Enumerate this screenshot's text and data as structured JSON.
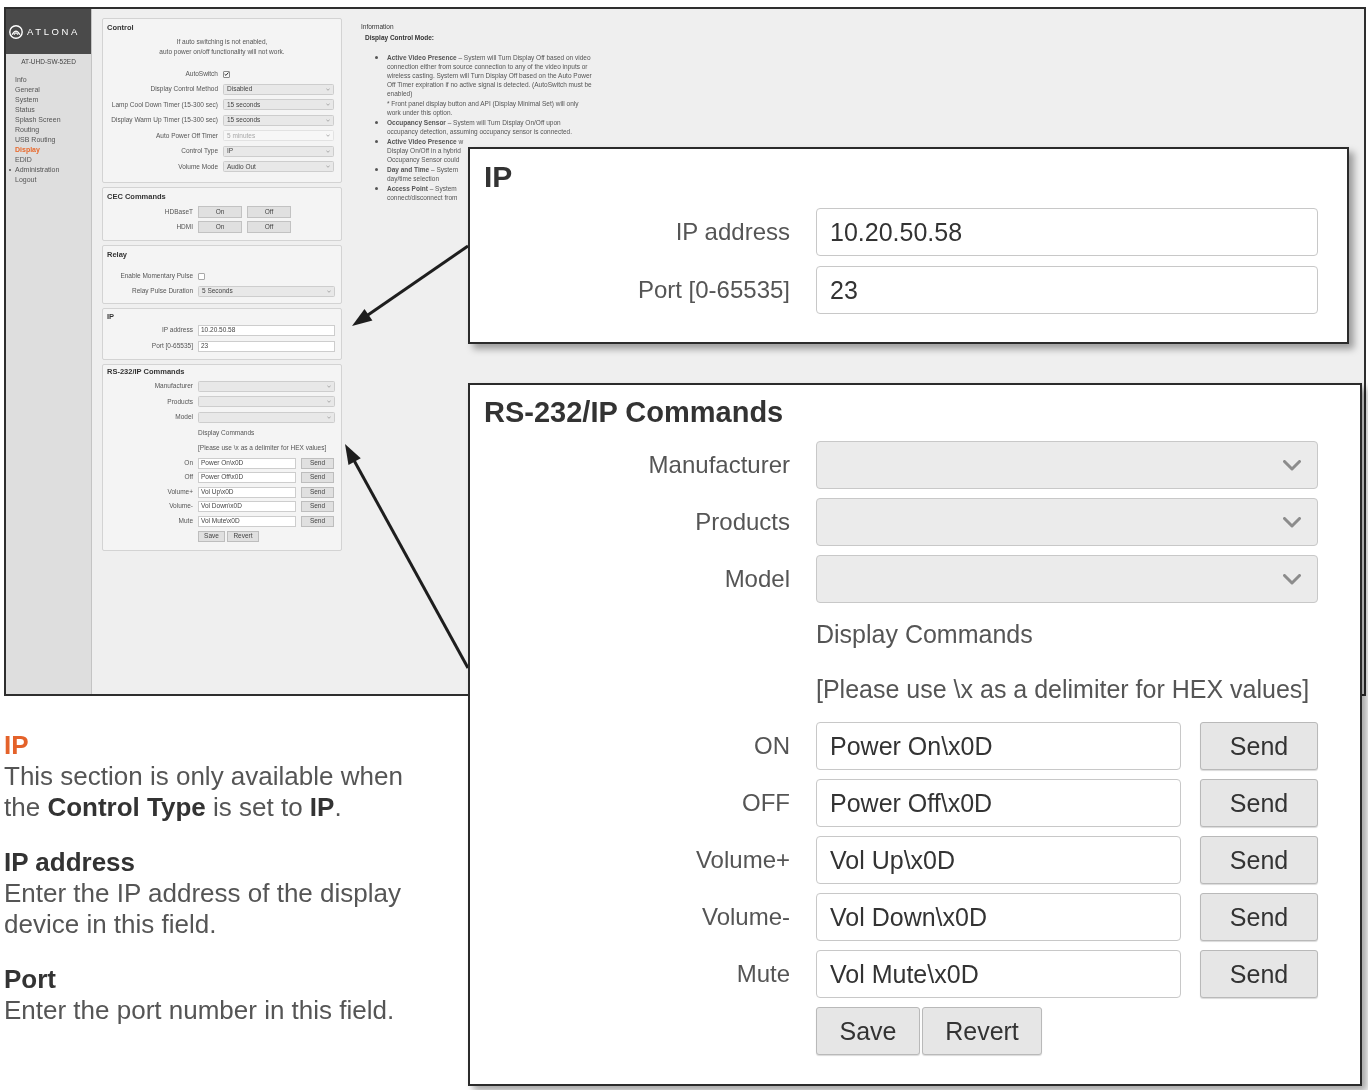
{
  "screenshot": {
    "sidebar": {
      "logo": "ATLONA",
      "device": "AT-UHD-SW-52ED",
      "items": [
        {
          "label": "Info",
          "selected": false,
          "expandable": false
        },
        {
          "label": "General",
          "selected": false,
          "expandable": false
        },
        {
          "label": "System",
          "selected": false,
          "expandable": false
        },
        {
          "label": "Status",
          "selected": false,
          "expandable": false
        },
        {
          "label": "Splash Screen",
          "selected": false,
          "expandable": false
        },
        {
          "label": "Routing",
          "selected": false,
          "expandable": false
        },
        {
          "label": "USB Routing",
          "selected": false,
          "expandable": false
        },
        {
          "label": "Display",
          "selected": true,
          "expandable": false
        },
        {
          "label": "EDID",
          "selected": false,
          "expandable": false
        },
        {
          "label": "Administration",
          "selected": false,
          "expandable": true
        },
        {
          "label": "Logout",
          "selected": false,
          "expandable": false
        }
      ]
    },
    "control": {
      "title": "Control",
      "notice": [
        "If auto switching is not enabled,",
        "auto power on/off functionality will not work."
      ],
      "fields": [
        {
          "kind": "checkbox",
          "label": "AutoSwitch",
          "checked": true
        },
        {
          "kind": "select",
          "label": "Display Control Method",
          "value": "Disabled",
          "disabled": false
        },
        {
          "kind": "select",
          "label": "Lamp Cool Down Timer (15-300 sec)",
          "value": "15 seconds",
          "disabled": false
        },
        {
          "kind": "select",
          "label": "Display Warm Up Timer (15-300 sec)",
          "value": "15 seconds",
          "disabled": false
        },
        {
          "kind": "select",
          "label": "Auto Power Off Timer",
          "value": "5 minutes",
          "disabled": true
        },
        {
          "kind": "select",
          "label": "Control Type",
          "value": "IP",
          "disabled": false
        },
        {
          "kind": "select",
          "label": "Volume Mode",
          "value": "Audio Out",
          "disabled": false
        }
      ]
    },
    "cec": {
      "title": "CEC Commands",
      "rows": [
        {
          "label": "HDBaseT",
          "buttons": [
            "On",
            "Off"
          ]
        },
        {
          "label": "HDMI",
          "buttons": [
            "On",
            "Off"
          ]
        }
      ]
    },
    "relay": {
      "title": "Relay",
      "fields": [
        {
          "kind": "checkbox",
          "label": "Enable Momentary Pulse",
          "checked": false
        },
        {
          "kind": "select",
          "label": "Relay Pulse Duration",
          "value": "5 Seconds",
          "disabled": false
        }
      ]
    },
    "ip": {
      "title": "IP",
      "fields": [
        {
          "label": "IP address",
          "value": "10.20.50.58"
        },
        {
          "label": "Port [0-65535]",
          "value": "23"
        }
      ]
    },
    "rs232": {
      "title": "RS-232/IP Commands",
      "selects": [
        {
          "label": "Manufacturer"
        },
        {
          "label": "Products"
        },
        {
          "label": "Model"
        }
      ],
      "heading": "Display Commands",
      "hint": "[Please use \\x as a delimiter for HEX values]",
      "commands": [
        {
          "label": "On",
          "value": "Power On\\x0D",
          "button": "Send"
        },
        {
          "label": "Off",
          "value": "Power Off\\x0D",
          "button": "Send"
        },
        {
          "label": "Volume+",
          "value": "Vol Up\\x0D",
          "button": "Send"
        },
        {
          "label": "Volume-",
          "value": "Vol Down\\x0D",
          "button": "Send"
        },
        {
          "label": "Mute",
          "value": "Vol Mute\\x0D",
          "button": "Send"
        }
      ],
      "actions": [
        "Save",
        "Revert"
      ]
    },
    "information": {
      "title": "Information",
      "subtitle": "Display Control Mode:",
      "bullets": [
        {
          "lines": [
            "**Active Video Presence** – System will Turn Display Off based on video",
            "connection either from source connection to any of the video inputs or",
            "wireless casting. System will Turn Display Off based on the Auto Power",
            "Off Timer expiration if no active signal is detected. (AutoSwitch must be",
            "enabled)"
          ],
          "note": [
            "* Front panel display button and API (Display Minimal Set) will only",
            "work under this option."
          ]
        },
        {
          "lines": [
            "**Occupancy Sensor** – System will Turn Display On/Off upon",
            "occupancy detection, assuming occupancy sensor is connected."
          ]
        },
        {
          "lines": [
            "**Active Video Presence** w",
            "Display On/Off in a hybrid",
            "Occupancy Sensor could"
          ]
        },
        {
          "lines": [
            "**Day and Time** – System",
            "day/time selection"
          ]
        },
        {
          "lines": [
            "**Access Point** – System",
            "connect/disconnect from"
          ]
        }
      ]
    }
  },
  "callout_ip": {
    "title": "IP",
    "fields": [
      {
        "label": "IP address",
        "value": "10.20.50.58"
      },
      {
        "label": "Port [0-65535]",
        "value": "23"
      }
    ]
  },
  "callout_rs232": {
    "title": "RS-232/IP Commands",
    "selects": [
      {
        "label": "Manufacturer"
      },
      {
        "label": "Products"
      },
      {
        "label": "Model"
      }
    ],
    "heading": "Display Commands",
    "hint": "[Please use \\x as a delimiter for HEX values]",
    "commands": [
      {
        "label": "ON",
        "value": "Power On\\x0D",
        "button": "Send"
      },
      {
        "label": "OFF",
        "value": "Power Off\\x0D",
        "button": "Send"
      },
      {
        "label": "Volume+",
        "value": "Vol Up\\x0D",
        "button": "Send"
      },
      {
        "label": "Volume-",
        "value": "Vol Down\\x0D",
        "button": "Send"
      },
      {
        "label": "Mute",
        "value": "Vol Mute\\x0D",
        "button": "Send"
      }
    ],
    "actions": [
      "Save",
      "Revert"
    ]
  },
  "description": [
    {
      "kind": "heading",
      "text": "IP"
    },
    {
      "kind": "paragraph",
      "text": "This section is only available when the **Control Type** is set to **IP**."
    },
    {
      "kind": "term",
      "text": "IP address"
    },
    {
      "kind": "paragraph",
      "text": "Enter the IP address of the display device in this field."
    },
    {
      "kind": "term",
      "text": "Port"
    },
    {
      "kind": "paragraph",
      "text": "Enter the port number in this field."
    }
  ]
}
